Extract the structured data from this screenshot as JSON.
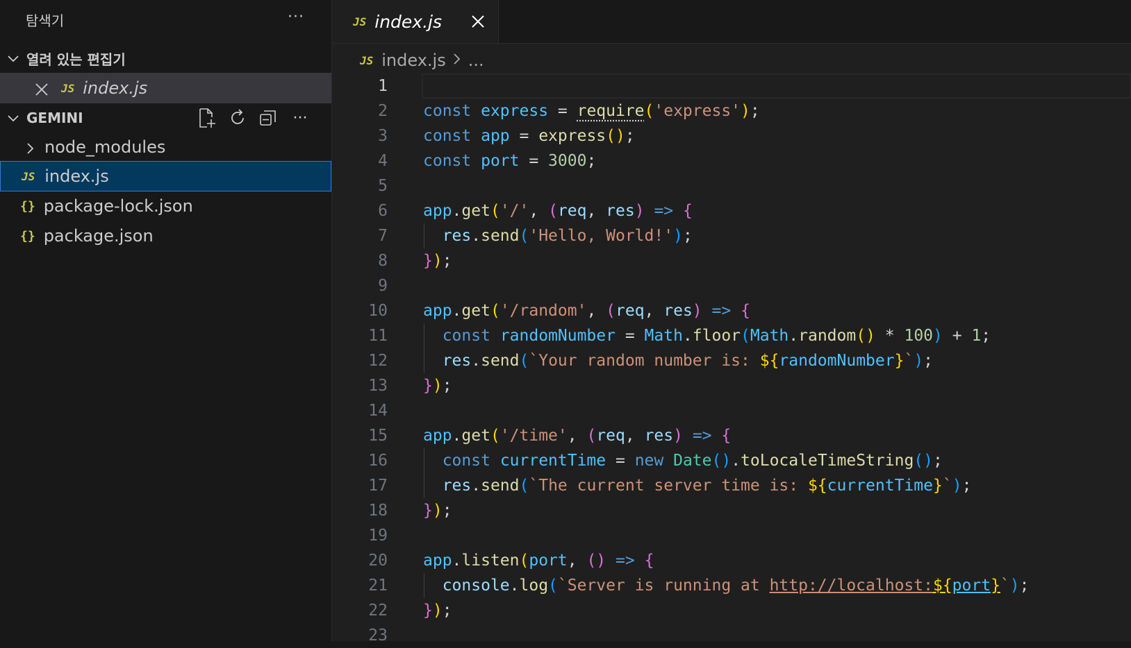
{
  "sidebar": {
    "title": "탐색기",
    "more": "···",
    "open_editors": {
      "label": "열려 있는 편집기",
      "items": [
        {
          "badge": "JS",
          "name": "index.js"
        }
      ]
    },
    "folder": {
      "label": "GEMINI",
      "more": "···",
      "items": [
        {
          "name": "node_modules"
        },
        {
          "badge": "JS",
          "name": "index.js"
        },
        {
          "badge": "{}",
          "name": "package-lock.json"
        },
        {
          "badge": "{}",
          "name": "package.json"
        }
      ]
    }
  },
  "tab": {
    "badge": "JS",
    "label": "index.js"
  },
  "breadcrumb": {
    "badge": "JS",
    "file": "index.js",
    "tail": "..."
  },
  "editor": {
    "line_numbers": [
      "1",
      "2",
      "3",
      "4",
      "5",
      "6",
      "7",
      "8",
      "9",
      "10",
      "11",
      "12",
      "13",
      "14",
      "15",
      "16",
      "17",
      "18",
      "19",
      "20",
      "21",
      "22",
      "23"
    ],
    "tokens": {
      "const": "const",
      "new": "new",
      "express_v": "express",
      "require": "require",
      "express_s": "'express'",
      "app": "app",
      "express_call": "express",
      "port": "port",
      "n3000": "3000",
      "get": "get",
      "root": "'/'",
      "req": "req",
      "res": "res",
      "arrow": "=>",
      "send": "send",
      "hello": "'Hello, World!'",
      "random_route": "'/random'",
      "randomNumber": "randomNumber",
      "Math": "Math",
      "floor": "floor",
      "random": "random",
      "n100": "100",
      "n1": "1",
      "tpl1": "Your random number is: ",
      "time_route": "'/time'",
      "currentTime": "currentTime",
      "Date": "Date",
      "toLocale": "toLocaleTimeString",
      "tpl2": "The current server time is: ",
      "listen": "listen",
      "console": "console",
      "log": "log",
      "tpl3": "Server is running at ",
      "url": "http://localhost:"
    }
  },
  "colors": {
    "keyword": "#569cd6",
    "variable": "#9cdcfe",
    "function": "#dcdcaa",
    "string": "#ce9178",
    "number": "#b5cea8",
    "selection_border": "#2b79d8"
  }
}
